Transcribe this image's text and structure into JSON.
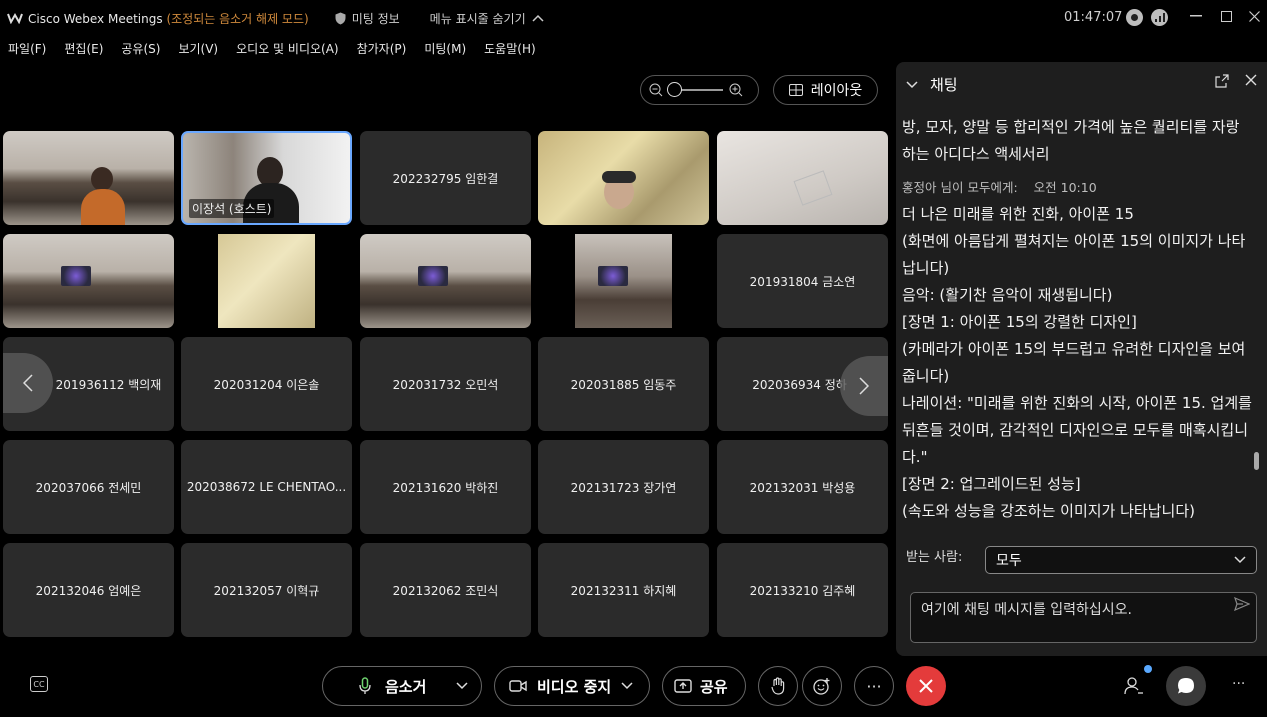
{
  "titlebar": {
    "app_name": "Cisco Webex Meetings",
    "mode": "(조정되는 음소거 해제 모드)",
    "meeting_info": "미팅 정보",
    "hide_menu": "메뉴 표시줄 숨기기",
    "clock": "01:47:07"
  },
  "menubar": {
    "items": [
      "파일(F)",
      "편집(E)",
      "공유(S)",
      "보기(V)",
      "오디오 및 비디오(A)",
      "참가자(P)",
      "미팅(M)",
      "도움말(H)"
    ]
  },
  "controls": {
    "layout_label": "레이아웃"
  },
  "tiles": {
    "host_label": "이장석 (호스트)",
    "names": [
      "202232795 임한결",
      "201931804 금소연",
      "201936112 백의재",
      "202031204 이은솔",
      "202031732 오민석",
      "202031885 임동주",
      "202036934 정하",
      "202037066 전세민",
      "202038672 LE CHENTAO...",
      "202131620 박하진",
      "202131723 장가연",
      "202132031 박성용",
      "202132046 엄예은",
      "202132057 이혁규",
      "202132062 조민식",
      "202132311 하지혜",
      "202133210 김주혜"
    ]
  },
  "chat": {
    "title": "채팅",
    "messages": [
      "방, 모자, 양말 등 합리적인 가격에 높은 퀄리티를 자랑하는 아디다스 액세서리"
    ],
    "meta_sender": "홍정아 님이 모두에게:",
    "meta_time": "오전 10:10",
    "lines": [
      "더 나은 미래를 위한 진화, 아이폰 15",
      "(화면에 아름답게 펼쳐지는 아이폰 15의 이미지가 나타납니다)",
      "음악: (활기찬 음악이 재생됩니다)",
      "[장면 1: 아이폰 15의 강렬한 디자인]",
      "(카메라가 아이폰 15의 부드럽고 유려한 디자인을 보여줍니다)",
      "나레이션: \"미래를 위한 진화의 시작, 아이폰 15. 업계를 뒤흔들 것이며, 감각적인 디자인으로 모두를 매혹시킵니다.\"",
      "[장면 2: 업그레이드된 성능]",
      "(속도와 성능을 강조하는 이미지가 나타납니다)"
    ],
    "recipient_label": "받는 사람:",
    "recipient_value": "모두",
    "input_placeholder": "여기에 채팅 메시지를 입력하십시오."
  },
  "bottombar": {
    "mute_label": "음소거",
    "video_label": "비디오 중지",
    "share_label": "공유"
  },
  "colors": {
    "accent": "#6aa8ff",
    "end_call": "#e43b3b",
    "mode_text": "#d08a3c"
  }
}
